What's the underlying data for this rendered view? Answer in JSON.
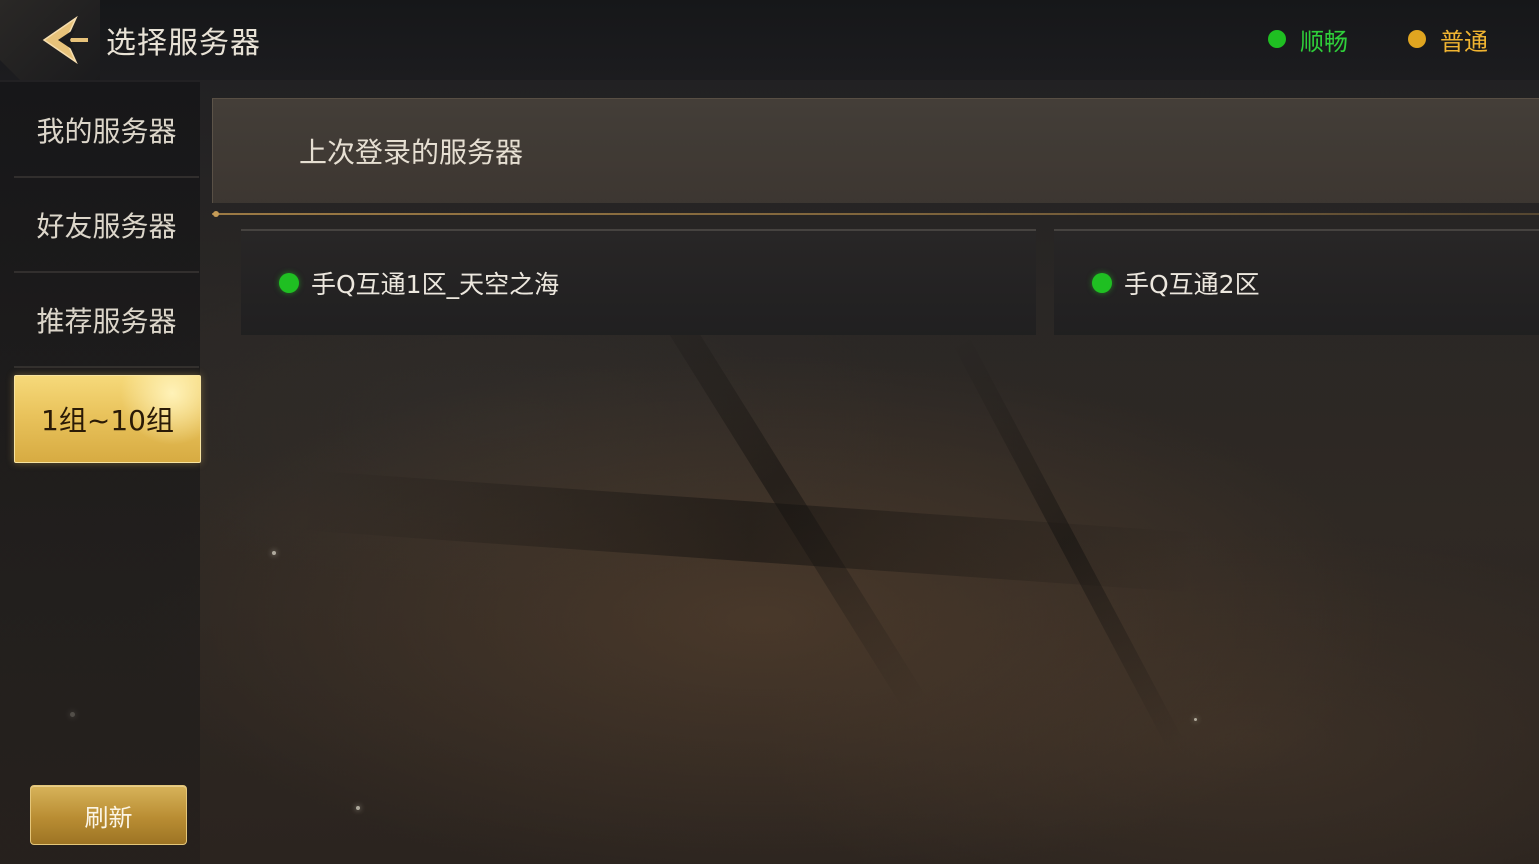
{
  "header": {
    "title": "选择服务器",
    "legend": [
      {
        "label": "顺畅",
        "color": "#1fbf22",
        "text_color": "#2fcf3a"
      },
      {
        "label": "普通",
        "color": "#e0a520",
        "text_color": "#f0b431"
      }
    ]
  },
  "sidebar": {
    "items": [
      {
        "label": "我的服务器",
        "active": false
      },
      {
        "label": "好友服务器",
        "active": false
      },
      {
        "label": "推荐服务器",
        "active": false
      },
      {
        "label": "1组~10组",
        "active": true
      }
    ],
    "refresh_label": "刷新"
  },
  "main": {
    "section_title": "上次登录的服务器",
    "servers": [
      {
        "name": "手Q互通1区_天空之海",
        "status": "顺畅",
        "status_color": "#1fbf22"
      },
      {
        "name": "手Q互通2区",
        "status": "顺畅",
        "status_color": "#1fbf22"
      }
    ]
  },
  "colors": {
    "accent_gold": "#e9c35c",
    "status_smooth": "#1fbf22",
    "status_normal": "#e0a520"
  }
}
